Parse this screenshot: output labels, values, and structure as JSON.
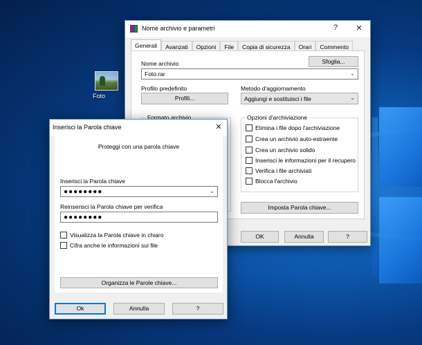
{
  "desktop": {
    "icon_label": "Foto"
  },
  "archive_dialog": {
    "title": "Nome archivio e parametri",
    "help_glyph": "?",
    "close_glyph": "✕",
    "tabs": [
      "Generali",
      "Avanzati",
      "Opzioni",
      "File",
      "Copia di sicurezza",
      "Orari",
      "Commento"
    ],
    "active_tab": "Generali",
    "archive_name_label": "Nome archivio",
    "browse_button": "Sfoglia...",
    "archive_name_value": "Foto.rar",
    "default_profile_label": "Profilo predefinito",
    "profiles_button": "Profili...",
    "update_method_label": "Metodo d'aggiornamento",
    "update_method_value": "Aggiungi e sostituisci i file",
    "archive_format_label": "Formato archivio",
    "options_group_label": "Opzioni d'archiviazione",
    "options": [
      "Elimina i file dopo l'archiviazione",
      "Crea un archivio auto-estraente",
      "Crea un archivio solido",
      "Inserisci le informazioni per il recupero",
      "Verifica i file archiviati",
      "Blocca l'archivio"
    ],
    "set_password_button": "Imposta Parola chiave...",
    "ok_button": "OK",
    "cancel_button": "Annulla",
    "help_button": "?"
  },
  "password_dialog": {
    "title": "Inserisci la Parola chiave",
    "close_glyph": "✕",
    "subtitle": "Proteggi con una parola chiave",
    "enter_label": "Inserisci la Parola chiave",
    "enter_value": "●●●●●●●●",
    "reenter_label": "Reinserisci la Parola chiave per verifica",
    "reenter_value": "●●●●●●●●",
    "show_password_label": "Visualizza la Parola chiave in chiaro",
    "encrypt_names_label": "Cifra anche le informazioni sui file",
    "organize_button": "Organizza le Parole chiave...",
    "ok_button": "Ok",
    "cancel_button": "Annulla",
    "help_button": "?"
  }
}
